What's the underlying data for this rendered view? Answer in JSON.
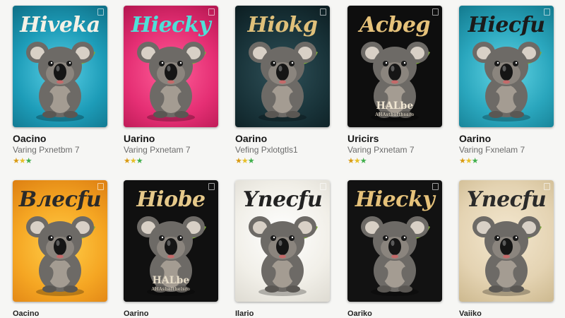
{
  "products": [
    {
      "title": "Hiveka",
      "name": "Oacino",
      "subtitle": "Varing Pxnetbm 7",
      "tagline": "",
      "tagline_small": "",
      "bg": "radial-gradient(circle at 50% 55%, #5ad0e6 0%, #1d9cb8 55%, #0f6f86 100%)",
      "title_color": "#f4f1e6",
      "poster_text_color": "#ffffff",
      "rating": "★★★"
    },
    {
      "title": "Hiecky",
      "name": "Uarino",
      "subtitle": "Varing Pxnetam 7",
      "tagline": "",
      "tagline_small": "",
      "bg": "radial-gradient(circle at 50% 55%, #ff5f99 0%, #e52f74 55%, #b3164f 100%)",
      "title_color": "#4ee0d8",
      "poster_text_color": "#ffffff",
      "rating": "★★★"
    },
    {
      "title": "Hiokg",
      "name": "Oarino",
      "subtitle": "Vefing Pxlotgtls1",
      "tagline": "",
      "tagline_small": "",
      "bg": "radial-gradient(circle at 50% 55%, #2f5058 0%, #183238 60%, #0c1d21 100%)",
      "title_color": "#dfc07a",
      "poster_text_color": "#ffffff",
      "rating": "★★★"
    },
    {
      "title": "Acbeg",
      "name": "Uricirs",
      "subtitle": "Varing Pxnetam 7",
      "tagline": "HALbe",
      "tagline_small": "AHAsthafthsaro",
      "bg": "#0e0e0e",
      "title_color": "#e6c27a",
      "poster_text_color": "#f0e6d2",
      "rating": "★★★"
    },
    {
      "title": "Hiecfu",
      "name": "Oarino",
      "subtitle": "Varing Fxnelam 7",
      "tagline": "",
      "tagline_small": "",
      "bg": "radial-gradient(circle at 50% 55%, #63d6e6 0%, #2aa6bd 55%, #137a8e 100%)",
      "title_color": "#1b1b1b",
      "poster_text_color": "#ffffff",
      "rating": "★★★"
    },
    {
      "title": "Bлecfu",
      "name": "",
      "subtitle": "",
      "tagline": "",
      "tagline_small": "",
      "bg": "radial-gradient(circle at 50% 55%, #ffcf4a 0%, #f5a623 55%, #dd7f12 100%)",
      "title_color": "#2a2a2a",
      "poster_text_color": "#ffffff",
      "rating": ""
    },
    {
      "title": "Hiobe",
      "name": "",
      "subtitle": "",
      "tagline": "HALbe",
      "tagline_small": "AHAshafthelsro",
      "bg": "#101010",
      "title_color": "#e6c98a",
      "poster_text_color": "#e6dcc8",
      "rating": ""
    },
    {
      "title": "Ynecfu",
      "name": "",
      "subtitle": "",
      "tagline": "",
      "tagline_small": "",
      "bg": "radial-gradient(circle at 50% 45%, #ffffff 0%, #f1efe8 60%, #dedbd2 100%)",
      "title_color": "#222222",
      "poster_text_color": "#333333",
      "rating": ""
    },
    {
      "title": "Hiecky",
      "name": "",
      "subtitle": "",
      "tagline": "",
      "tagline_small": "",
      "bg": "#121212",
      "title_color": "#e6c27a",
      "poster_text_color": "#ffffff",
      "rating": ""
    },
    {
      "title": "Ynecfu",
      "name": "",
      "subtitle": "",
      "tagline": "",
      "tagline_small": "",
      "bg": "radial-gradient(circle at 50% 45%, #f3e7cf 0%, #e4d3b2 60%, #cdb98f 100%)",
      "title_color": "#2a2a2a",
      "poster_text_color": "#333333",
      "rating": ""
    }
  ],
  "cutoff_texts": [
    "Oacino",
    "Oarino",
    "Ilario",
    "Oariko",
    "Vaiiko"
  ],
  "colors": {
    "page_bg": "#f6f6f4",
    "koala_fur": "#6d6a66",
    "leaf": "#7faa3b"
  },
  "icons": [
    "koala-illustration-icon",
    "leaf-icon",
    "corner-badge-icon",
    "star-icon"
  ]
}
